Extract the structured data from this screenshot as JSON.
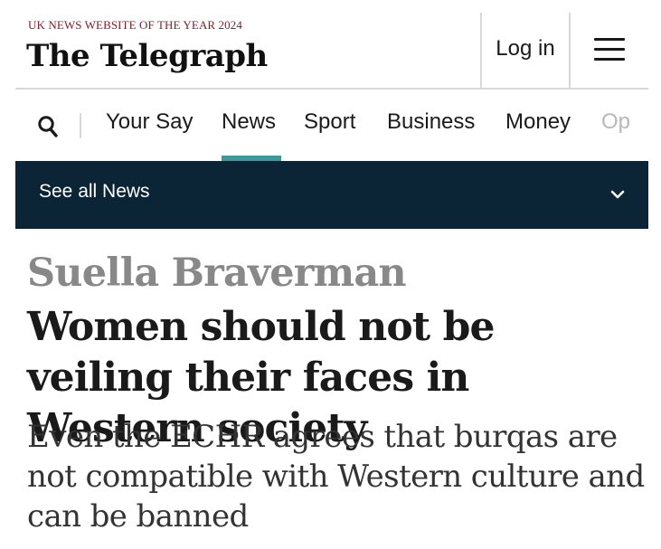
{
  "header": {
    "award": "UK NEWS WEBSITE OF THE YEAR 2024",
    "logo": "The Telegraph",
    "login_label": "Log in",
    "menu_icon": "hamburger-menu-icon"
  },
  "nav": {
    "search_icon": "search-icon",
    "items": [
      {
        "label": "Your Say"
      },
      {
        "label": "News",
        "active": true
      },
      {
        "label": "Sport"
      },
      {
        "label": "Business"
      },
      {
        "label": "Money"
      },
      {
        "label": "Op"
      }
    ],
    "active_color": "#3e9a9a"
  },
  "subnav": {
    "label": "See all News",
    "chevron_icon": "chevron-down-icon",
    "background": "#0b2537"
  },
  "article": {
    "kicker": "Suella Braverman",
    "headline": "Women should not be veiling their faces in Western society",
    "standfirst": "Even the ECHR agrees that burqas are not compatible with Western culture and can be banned"
  }
}
